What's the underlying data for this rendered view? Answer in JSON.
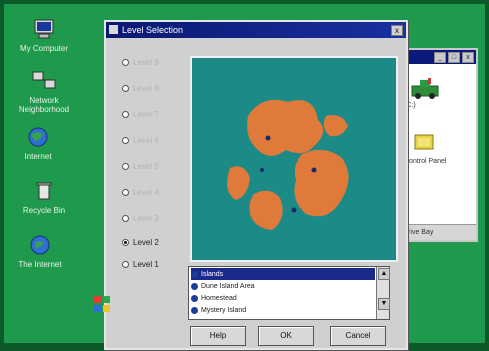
{
  "colors": {
    "desktop": "#1f9a4c",
    "titlebar": "#0a1872",
    "map_sea": "#1c8a86",
    "map_land": "#e07a3a",
    "selection": "#1b2a8a"
  },
  "desktop": {
    "icons": [
      {
        "name": "My Computer",
        "icon": "computer-icon"
      },
      {
        "name": "Network Neighborhood",
        "icon": "network-icon"
      },
      {
        "name": "Internet",
        "icon": "globe-icon"
      },
      {
        "name": "Recycle Bin",
        "icon": "recycle-bin-icon"
      },
      {
        "name": "The Internet",
        "icon": "globe-icon"
      }
    ]
  },
  "background_window": {
    "items": [
      "(C:)",
      "Control Panel"
    ],
    "status": "Drive Bay"
  },
  "dialog": {
    "title": "Level Selection",
    "close_label": "x",
    "levels": [
      {
        "label": "Level 9",
        "selected": false,
        "enabled": false
      },
      {
        "label": "Level 8",
        "selected": false,
        "enabled": false
      },
      {
        "label": "Level 7",
        "selected": false,
        "enabled": false
      },
      {
        "label": "Level 6",
        "selected": false,
        "enabled": false
      },
      {
        "label": "Level 5",
        "selected": false,
        "enabled": false
      },
      {
        "label": "Level 4",
        "selected": false,
        "enabled": false
      },
      {
        "label": "Level 3",
        "selected": false,
        "enabled": false
      },
      {
        "label": "Level 2",
        "selected": true,
        "enabled": true
      },
      {
        "label": "Level 1",
        "selected": false,
        "enabled": true
      }
    ],
    "list_items": [
      {
        "label": "Islands",
        "selected": true
      },
      {
        "label": "Dune Island Area",
        "selected": false
      },
      {
        "label": "Homestead",
        "selected": false
      },
      {
        "label": "Mystery Island",
        "selected": false
      }
    ],
    "buttons": {
      "help": "Help",
      "ok": "OK",
      "cancel": "Cancel"
    }
  }
}
